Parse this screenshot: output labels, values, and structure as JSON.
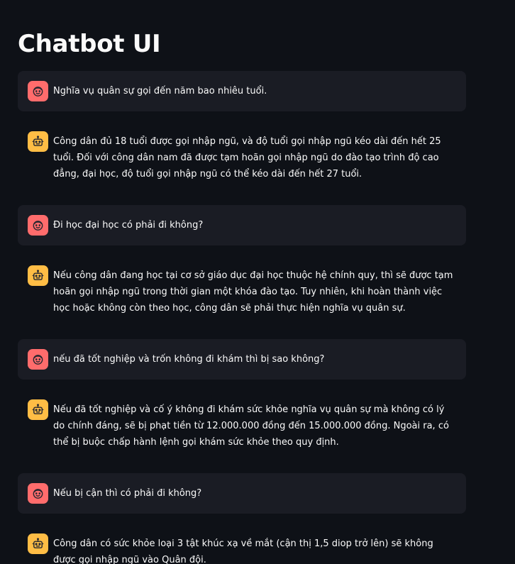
{
  "app": {
    "title": "Chatbot UI"
  },
  "colors": {
    "background": "#0e1117",
    "user_bubble": "#1a1c24",
    "user_avatar": "#ff6c6c",
    "assistant_avatar": "#ffbd45",
    "text": "#fafafa"
  },
  "messages": [
    {
      "role": "user",
      "avatar_icon": "user-face-icon",
      "text": "Nghĩa vụ quân sự gọi đến năm bao nhiêu tuổi."
    },
    {
      "role": "assistant",
      "avatar_icon": "robot-icon",
      "text": "Công dân đủ 18 tuổi được gọi nhập ngũ, và độ tuổi gọi nhập ngũ kéo dài đến hết 25 tuổi. Đối với công dân nam đã được tạm hoãn gọi nhập ngũ do đào tạo trình độ cao đẳng, đại học, độ tuổi gọi nhập ngũ có thể kéo dài đến hết 27 tuổi."
    },
    {
      "role": "user",
      "avatar_icon": "user-face-icon",
      "text": "Đi học đại học có phải đi không?"
    },
    {
      "role": "assistant",
      "avatar_icon": "robot-icon",
      "text": "Nếu công dân đang học tại cơ sở giáo dục đại học thuộc hệ chính quy, thì sẽ được tạm hoãn gọi nhập ngũ trong thời gian một khóa đào tạo. Tuy nhiên, khi hoàn thành việc học hoặc không còn theo học, công dân sẽ phải thực hiện nghĩa vụ quân sự."
    },
    {
      "role": "user",
      "avatar_icon": "user-face-icon",
      "text": "nếu đã tốt nghiệp và trốn không đi khám thì bị sao không?"
    },
    {
      "role": "assistant",
      "avatar_icon": "robot-icon",
      "text": "Nếu đã tốt nghiệp và cố ý không đi khám sức khỏe nghĩa vụ quân sự mà không có lý do chính đáng, sẽ bị phạt tiền từ 12.000.000 đồng đến 15.000.000 đồng. Ngoài ra, có thể bị buộc chấp hành lệnh gọi khám sức khỏe theo quy định."
    },
    {
      "role": "user",
      "avatar_icon": "user-face-icon",
      "text": "Nếu bị cận thì có phải đi không?"
    },
    {
      "role": "assistant",
      "avatar_icon": "robot-icon",
      "text": "Công dân có sức khỏe loại 3 tật khúc xạ về mắt (cận thị 1,5 diop trở lên) sẽ không được gọi nhập ngũ vào Quân đội."
    }
  ]
}
